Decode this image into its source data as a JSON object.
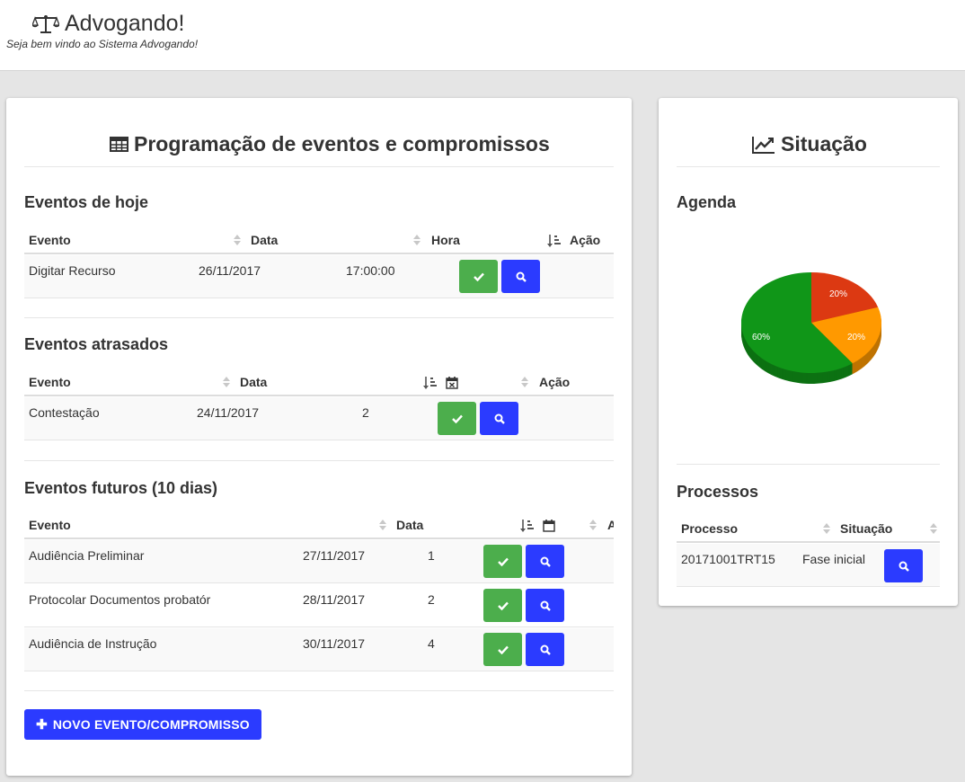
{
  "header": {
    "brand": "Advogando!",
    "tagline": "Seja bem vindo ao Sistema Advogando!"
  },
  "left_panel": {
    "title": "Programação de eventos e compromissos",
    "today": {
      "title": "Eventos de hoje",
      "columns": [
        "Evento",
        "Data",
        "Hora",
        "Ação"
      ],
      "rows": [
        {
          "evento": "Digitar Recurso",
          "data": "26/11/2017",
          "hora": "17:00:00"
        }
      ]
    },
    "late": {
      "title": "Eventos atrasados",
      "columns": [
        "Evento",
        "Data",
        "",
        "Ação"
      ],
      "rows": [
        {
          "evento": "Contestação",
          "data": "24/11/2017",
          "dias": "2"
        }
      ]
    },
    "future": {
      "title": "Eventos futuros (10 dias)",
      "columns": [
        "Evento",
        "Data",
        "",
        "A"
      ],
      "rows": [
        {
          "evento": "Audiência Preliminar",
          "data": "27/11/2017",
          "dias": "1"
        },
        {
          "evento": "Protocolar Documentos probatór",
          "data": "28/11/2017",
          "dias": "2"
        },
        {
          "evento": "Audiência de Instrução",
          "data": "30/11/2017",
          "dias": "4"
        }
      ]
    },
    "new_button": "NOVO EVENTO/COMPROMISSO"
  },
  "right_panel": {
    "title": "Situação",
    "agenda_title": "Agenda",
    "chart_data": {
      "type": "pie",
      "slices": [
        {
          "label": "20%",
          "value": 20,
          "color": "#dc3912"
        },
        {
          "label": "20%",
          "value": 20,
          "color": "#ff9900"
        },
        {
          "label": "60%",
          "value": 60,
          "color": "#109618"
        }
      ]
    },
    "processos_title": "Processos",
    "processos_columns": [
      "Processo",
      "Situação"
    ],
    "processos_rows": [
      {
        "processo": "20171001TRT15",
        "situacao": "Fase inicial"
      }
    ]
  },
  "colors": {
    "confirm": "#4cae4c",
    "search": "#2b3bff",
    "background": "#e5e5e5"
  }
}
